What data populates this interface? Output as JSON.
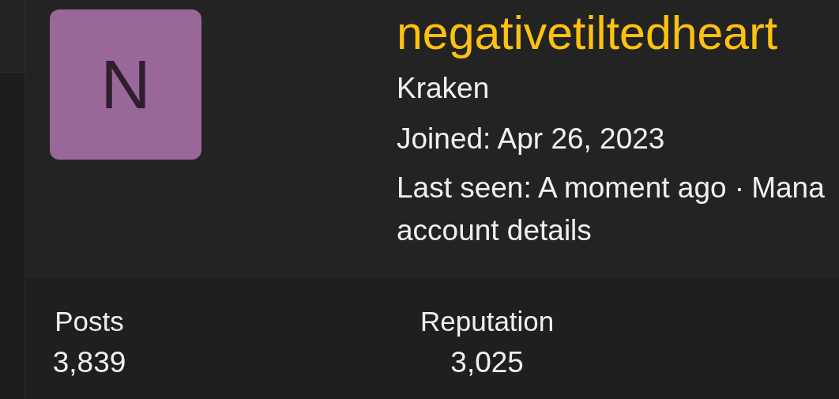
{
  "profile": {
    "avatar_letter": "N",
    "username": "negativetiltedheart",
    "rank": "Kraken",
    "joined": "Joined: Apr 26, 2023",
    "last_seen": "Last seen: A moment ago ·",
    "manage_link": [
      "Mana",
      "account details"
    ]
  },
  "stats": [
    {
      "label": "Posts",
      "value": "3,839"
    },
    {
      "label": "Reputation",
      "value": "3,025"
    }
  ]
}
